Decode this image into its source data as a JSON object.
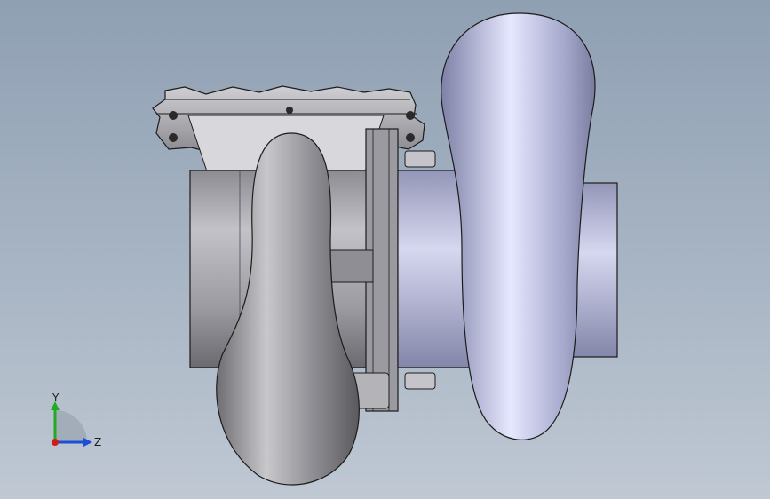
{
  "viewport": {
    "model_name": "turbocharger-assembly",
    "colors": {
      "background_top": "#8fa0b3",
      "background_bottom": "#bfc8d3",
      "turbine_metal": "#9a9aa0",
      "compressor_metal": "#aeb0cf",
      "edge": "#1c1c1c"
    }
  },
  "triad": {
    "y_label": "Y",
    "z_label": "Z",
    "colors": {
      "x": "#d11a1a",
      "y": "#22aa22",
      "z": "#1c4fd6"
    }
  }
}
